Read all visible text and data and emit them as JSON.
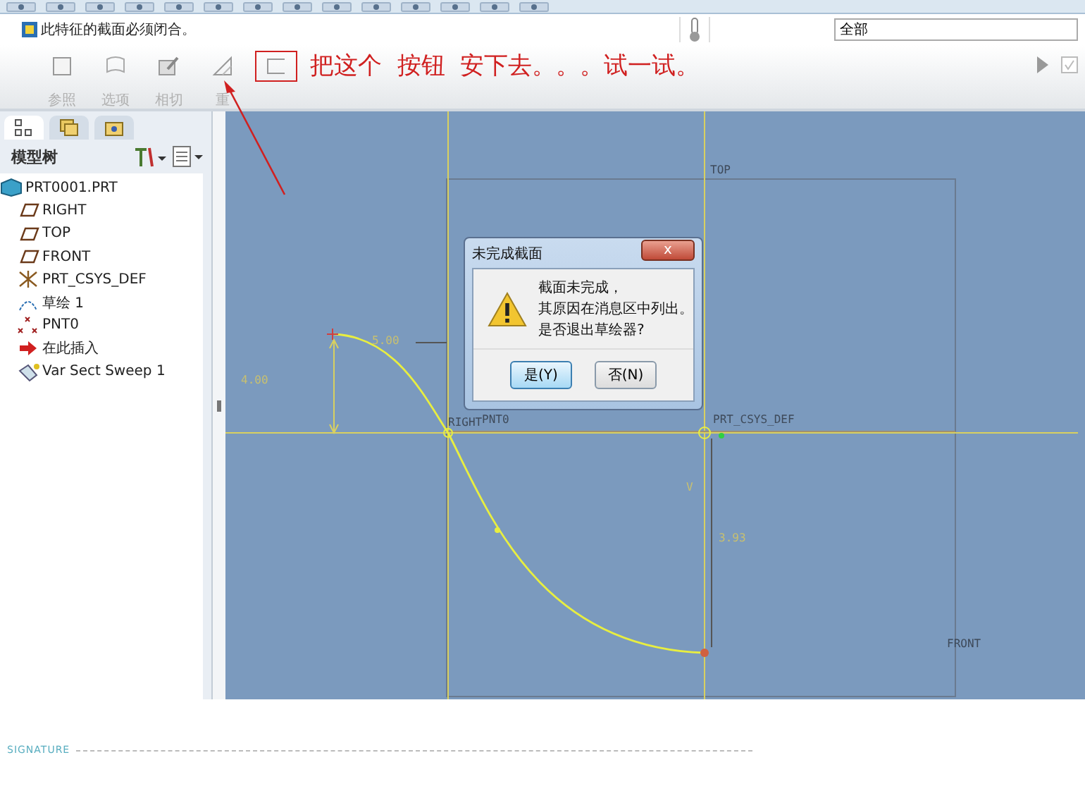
{
  "message_bar": {
    "text": "此特征的截面必须闭合。",
    "filter": {
      "value": "全部"
    }
  },
  "ribbon": {
    "tools": [
      {
        "label": "参照",
        "kind": "square",
        "highlighted": false
      },
      {
        "label": "选项",
        "kind": "flag",
        "highlighted": false
      },
      {
        "label": "相切",
        "kind": "pencil",
        "highlighted": false
      },
      {
        "label": "重",
        "kind": "triangle",
        "highlighted": false
      },
      {
        "kind": "open-rect",
        "highlighted": true
      }
    ],
    "annotation": "把这个  按钮  安下去。。。试一试。"
  },
  "model_tree": {
    "title": "模型树",
    "tabs": [
      {
        "kind": "tree",
        "selected": true
      },
      {
        "kind": "layers",
        "selected": false
      },
      {
        "kind": "folder",
        "selected": false
      }
    ],
    "items": [
      {
        "label": "PRT0001.PRT",
        "kind": "part",
        "children": [
          {
            "label": "RIGHT",
            "kind": "plane"
          },
          {
            "label": "TOP",
            "kind": "plane"
          },
          {
            "label": "FRONT",
            "kind": "plane"
          },
          {
            "label": "PRT_CSYS_DEF",
            "kind": "csys"
          },
          {
            "label": "草绘 1",
            "kind": "sketch"
          },
          {
            "label": "PNT0",
            "kind": "point"
          },
          {
            "label": "在此插入",
            "kind": "insert"
          },
          {
            "label": "Var Sect Sweep 1",
            "kind": "sweep"
          }
        ]
      }
    ]
  },
  "sketch": {
    "labels": [
      {
        "text": "TOP",
        "kind": "ref"
      },
      {
        "text": "5.00",
        "kind": "dim"
      },
      {
        "text": "4.00",
        "kind": "dim"
      },
      {
        "text": "RIGHT",
        "kind": "ref"
      },
      {
        "text": "PNT0",
        "kind": "ref"
      },
      {
        "text": "PRT_CSYS_DEF",
        "kind": "ref"
      },
      {
        "text": "V",
        "kind": "dim"
      },
      {
        "text": "3.93",
        "kind": "dim"
      },
      {
        "text": "FRONT",
        "kind": "ref"
      }
    ]
  },
  "dialog": {
    "title": "未完成截面",
    "close": "x",
    "lines": [
      "截面未完成，",
      "其原因在消息区中列出。",
      "是否退出草绘器?"
    ],
    "buttons": [
      {
        "label": "是(Y)",
        "selected": true
      },
      {
        "label": "否(N)",
        "selected": false
      }
    ]
  },
  "footer": {
    "signature": "SIGNATURE"
  }
}
